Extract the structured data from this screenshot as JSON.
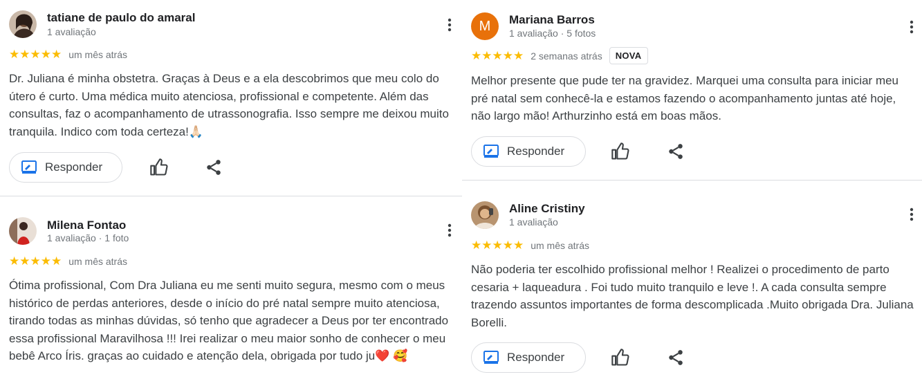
{
  "reviews": [
    {
      "name": "tatiane de paulo do amaral",
      "meta": "1 avaliação",
      "stars": "★★★★★",
      "when": "um mês atrás",
      "text": "Dr. Juliana é minha obstetra. Graças à Deus e a ela descobrimos que meu colo do útero é curto. Uma médica muito atenciosa, profissional e competente. Além das consultas, faz o acompanhamento de utrassonografia. Isso sempre me deixou muito tranquila. Indico com toda certeza!🙏🏻",
      "reply_label": "Responder"
    },
    {
      "name": "Milena Fontao",
      "meta": "1 avaliação · 1 foto",
      "stars": "★★★★★",
      "when": "um mês atrás",
      "text": "Ótima profissional, Com Dra Juliana eu me senti muito segura, mesmo com o meus histórico de perdas anteriores, desde o início do pré natal sempre muito atenciosa, tirando todas as minhas dúvidas, só tenho que agradecer a Deus por ter encontrado essa profissional Maravilhosa !!! Irei realizar o meu maior sonho de conhecer o meu bebê Arco Íris. graças ao cuidado e atenção dela, obrigada por tudo ju❤️ 🥰",
      "reply_label": "Responder"
    },
    {
      "name": "Mariana Barros",
      "avatar_letter": "M",
      "meta": "1 avaliação · 5 fotos",
      "stars": "★★★★★",
      "when": "2 semanas atrás",
      "badge": "NOVA",
      "text": "Melhor presente que pude ter na gravidez. Marquei uma consulta para iniciar meu pré natal sem conhecê-la e estamos fazendo o acompanhamento juntas até hoje, não largo mão! Arthurzinho está em boas mãos.",
      "reply_label": "Responder"
    },
    {
      "name": "Aline Cristiny",
      "meta": "1 avaliação",
      "stars": "★★★★★",
      "when": "um mês atrás",
      "text": "Não poderia ter escolhido profissional melhor ! Realizei o procedimento de parto cesaria + laqueadura . Foi tudo muito tranquilo e leve !. A cada consulta sempre trazendo assuntos importantes de forma descomplicada .Muito obrigada Dra. Juliana Borelli.",
      "reply_label": "Responder"
    }
  ],
  "colors": {
    "star": "#fbbc04",
    "reply_icon": "#1a73e8",
    "avatar_orange": "#e8710a"
  },
  "icons": [
    "more-vert-icon",
    "reply-icon",
    "thumb-up-icon",
    "share-icon"
  ]
}
